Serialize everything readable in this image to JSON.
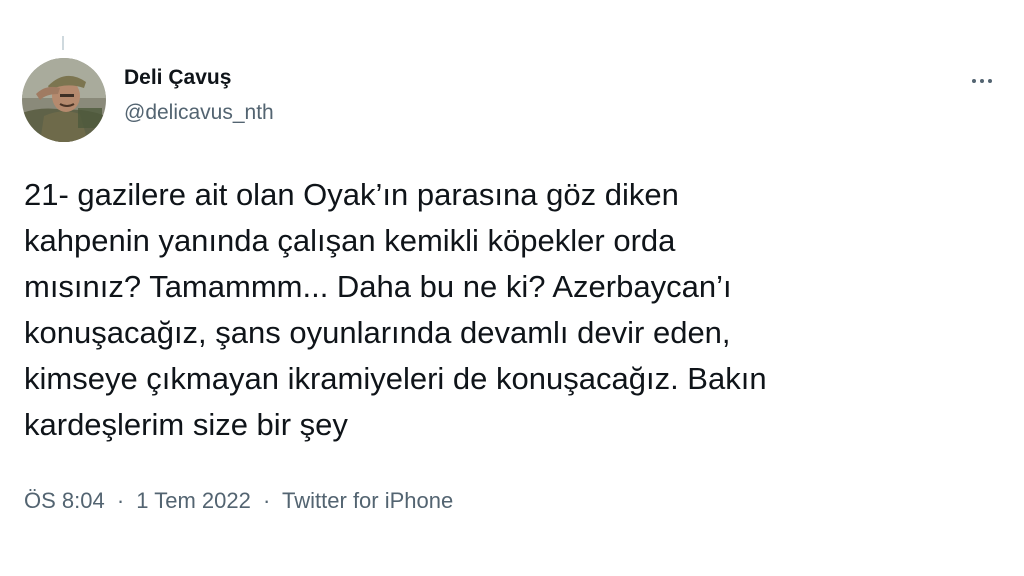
{
  "tweet": {
    "author": {
      "display_name": "Deli Çavuş",
      "handle": "@delicavus_nth",
      "avatar_icon": "profile-photo-soldier-saluting"
    },
    "more_icon": "ellipsis-horizontal-icon",
    "text_lines": [
      "21- gazilere ait olan Oyak’ın parasına göz diken",
      "kahpenin yanında çalışan kemikli köpekler orda",
      "mısınız? Tamammm... Daha bu ne ki? Azerbaycan’ı",
      "konuşacağız, şans oyunlarında devamlı devir eden,",
      "kimseye çıkmayan ikramiyeleri de konuşacağız. Bakın",
      "kardeşlerim size bir şey"
    ],
    "meta": {
      "time": "ÖS 8:04",
      "separator": "·",
      "date": "1 Tem 2022",
      "source": "Twitter for iPhone"
    }
  },
  "colors": {
    "primary_text": "#0f1419",
    "secondary_text": "#536471",
    "thread_line": "#cfd9de",
    "background": "#ffffff"
  }
}
